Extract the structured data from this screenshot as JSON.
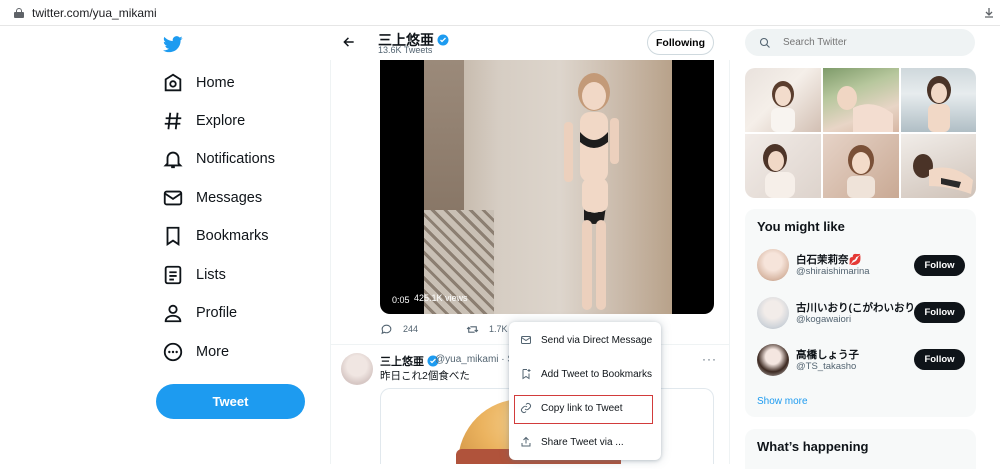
{
  "browser": {
    "url": "twitter.com/yua_mikami"
  },
  "nav": {
    "items": [
      {
        "label": "Home",
        "icon": "home-icon"
      },
      {
        "label": "Explore",
        "icon": "hashtag-icon"
      },
      {
        "label": "Notifications",
        "icon": "bell-icon"
      },
      {
        "label": "Messages",
        "icon": "envelope-icon"
      },
      {
        "label": "Bookmarks",
        "icon": "bookmark-icon"
      },
      {
        "label": "Lists",
        "icon": "list-icon"
      },
      {
        "label": "Profile",
        "icon": "person-icon"
      },
      {
        "label": "More",
        "icon": "more-circle-icon"
      }
    ],
    "tweet_button": "Tweet"
  },
  "header": {
    "name": "三上悠亜",
    "tweet_count": "13.6K Tweets",
    "following_label": "Following"
  },
  "video": {
    "time": "0:05",
    "views": "425.1K views"
  },
  "tweet1": {
    "replies": "244",
    "retweets": "1.7K"
  },
  "tweet2": {
    "name": "三上悠亜",
    "handle": "@yua_mikami · S",
    "text": "昨日これ2個食べた",
    "more": "···"
  },
  "context_menu": {
    "items": [
      {
        "label": "Send via Direct Message",
        "icon": "envelope-icon"
      },
      {
        "label": "Add Tweet to Bookmarks",
        "icon": "bookmark-add-icon"
      },
      {
        "label": "Copy link to Tweet",
        "icon": "link-icon"
      },
      {
        "label": "Share Tweet via ...",
        "icon": "share-icon"
      }
    ]
  },
  "search": {
    "placeholder": "Search Twitter"
  },
  "suggestions": {
    "title": "You might like",
    "users": [
      {
        "name": "白石茉莉奈💋",
        "handle": "@shiraishimarina",
        "follow": "Follow"
      },
      {
        "name": "古川いおり(こがわいおり",
        "handle": "@kogawaiori",
        "follow": "Follow"
      },
      {
        "name": "高橋しょう子",
        "handle": "@TS_takasho",
        "follow": "Follow"
      }
    ],
    "show_more": "Show more"
  },
  "happening": {
    "title": "What’s happening"
  },
  "colors": {
    "accent": "#1d9bf0",
    "text": "#0f1419",
    "muted": "#536471",
    "highlight": "#d23b3b"
  }
}
